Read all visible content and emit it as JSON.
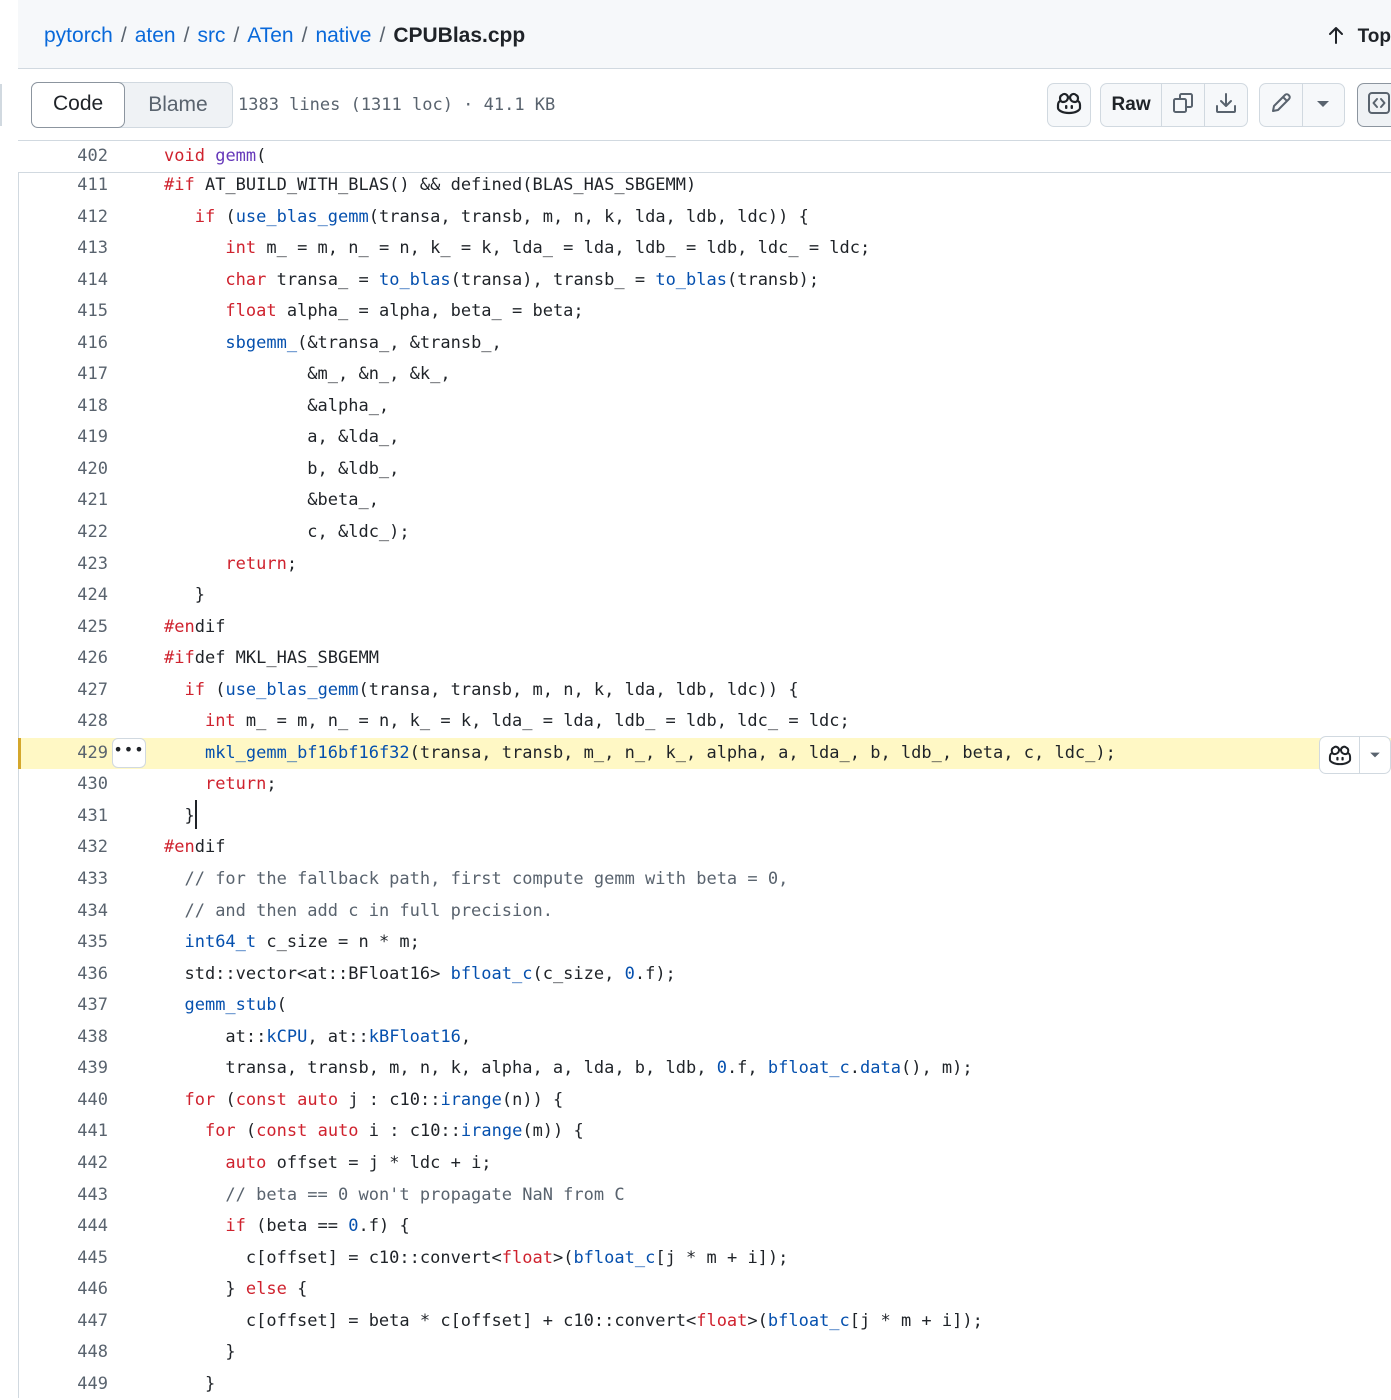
{
  "breadcrumb": {
    "parts": [
      "pytorch",
      "aten",
      "src",
      "ATen",
      "native"
    ],
    "separator": "/",
    "file": "CPUBlas.cpp"
  },
  "top_link": "Top",
  "toolbar": {
    "tab_code": "Code",
    "tab_blame": "Blame",
    "file_meta": "1383 lines (1311 loc) · 41.1 KB",
    "raw_label": "Raw"
  },
  "sticky": {
    "line_number": "402",
    "code": "void gemm("
  },
  "code_lines": [
    {
      "n": "411",
      "t": "#if AT_BUILD_WITH_BLAS() && defined(BLAS_HAS_SBGEMM)"
    },
    {
      "n": "412",
      "t": "   if (use_blas_gemm(transa, transb, m, n, k, lda, ldb, ldc)) {"
    },
    {
      "n": "413",
      "t": "      int m_ = m, n_ = n, k_ = k, lda_ = lda, ldb_ = ldb, ldc_ = ldc;"
    },
    {
      "n": "414",
      "t": "      char transa_ = to_blas(transa), transb_ = to_blas(transb);"
    },
    {
      "n": "415",
      "t": "      float alpha_ = alpha, beta_ = beta;"
    },
    {
      "n": "416",
      "t": "      sbgemm_(&transa_, &transb_,"
    },
    {
      "n": "417",
      "t": "              &m_, &n_, &k_,"
    },
    {
      "n": "418",
      "t": "              &alpha_,"
    },
    {
      "n": "419",
      "t": "              a, &lda_,"
    },
    {
      "n": "420",
      "t": "              b, &ldb_,"
    },
    {
      "n": "421",
      "t": "              &beta_,"
    },
    {
      "n": "422",
      "t": "              c, &ldc_);"
    },
    {
      "n": "423",
      "t": "      return;"
    },
    {
      "n": "424",
      "t": "   }"
    },
    {
      "n": "425",
      "t": "#endif"
    },
    {
      "n": "426",
      "t": "#ifdef MKL_HAS_SBGEMM"
    },
    {
      "n": "427",
      "t": "  if (use_blas_gemm(transa, transb, m, n, k, lda, ldb, ldc)) {"
    },
    {
      "n": "428",
      "t": "    int m_ = m, n_ = n, k_ = k, lda_ = lda, ldb_ = ldb, ldc_ = ldc;"
    },
    {
      "n": "429",
      "t": "    mkl_gemm_bf16bf16f32(transa, transb, m_, n_, k_, alpha, a, lda_, b, ldb_, beta, c, ldc_);"
    },
    {
      "n": "430",
      "t": "    return;"
    },
    {
      "n": "431",
      "t": "  }"
    },
    {
      "n": "432",
      "t": "#endif"
    },
    {
      "n": "433",
      "t": "  // for the fallback path, first compute gemm with beta = 0,"
    },
    {
      "n": "434",
      "t": "  // and then add c in full precision."
    },
    {
      "n": "435",
      "t": "  int64_t c_size = n * m;"
    },
    {
      "n": "436",
      "t": "  std::vector<at::BFloat16> bfloat_c(c_size, 0.f);"
    },
    {
      "n": "437",
      "t": "  gemm_stub("
    },
    {
      "n": "438",
      "t": "      at::kCPU, at::kBFloat16,"
    },
    {
      "n": "439",
      "t": "      transa, transb, m, n, k, alpha, a, lda, b, ldb, 0.f, bfloat_c.data(), m);"
    },
    {
      "n": "440",
      "t": "  for (const auto j : c10::irange(n)) {"
    },
    {
      "n": "441",
      "t": "    for (const auto i : c10::irange(m)) {"
    },
    {
      "n": "442",
      "t": "      auto offset = j * ldc + i;"
    },
    {
      "n": "443",
      "t": "      // beta == 0 won't propagate NaN from C"
    },
    {
      "n": "444",
      "t": "      if (beta == 0.f) {"
    },
    {
      "n": "445",
      "t": "        c[offset] = c10::convert<float>(bfloat_c[j * m + i]);"
    },
    {
      "n": "446",
      "t": "      } else {"
    },
    {
      "n": "447",
      "t": "        c[offset] = beta * c[offset] + c10::convert<float>(bfloat_c[j * m + i]);"
    },
    {
      "n": "448",
      "t": "      }"
    },
    {
      "n": "449",
      "t": "    }"
    }
  ],
  "highlighted_line": "429",
  "cursor_line": "431",
  "line_menu_label": "•••",
  "colors": {
    "link": "#0969da",
    "keyword": "#cf222e",
    "function": "#0550ae",
    "highlight": "#fff8c5",
    "highlight_bar": "#d4a72c"
  }
}
